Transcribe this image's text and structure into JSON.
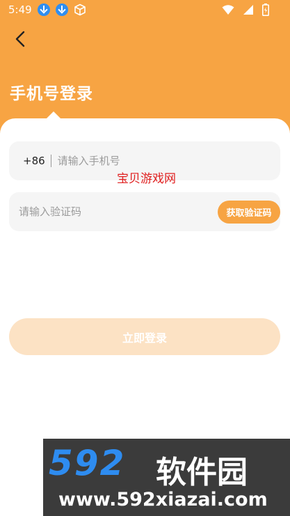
{
  "status_bar": {
    "time": "5:49"
  },
  "header": {
    "title": "手机号登录"
  },
  "form": {
    "country_code": "+86",
    "phone_placeholder": "请输入手机号",
    "code_placeholder": "请输入验证码",
    "get_code_label": "获取验证码",
    "login_label": "立即登录"
  },
  "overlay": {
    "watermark_text": "宝贝游戏网"
  },
  "banner": {
    "logo_number": "592",
    "site_name": "软件园",
    "url": "www.592xiazai.com"
  },
  "colors": {
    "accent": "#F7A443",
    "login_disabled": "#FCE2C4",
    "field_bg": "#F5F5F5"
  }
}
